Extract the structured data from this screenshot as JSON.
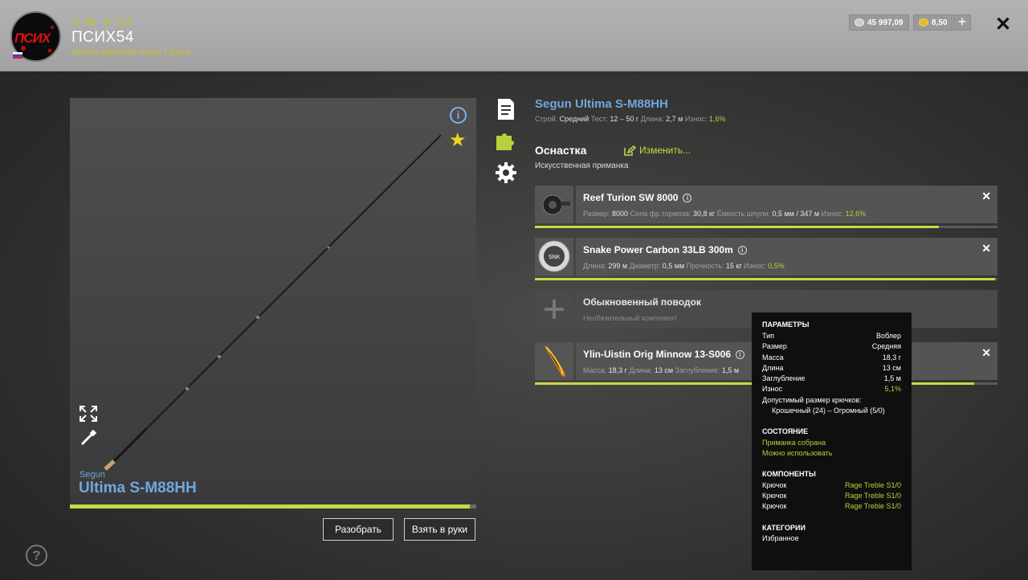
{
  "header": {
    "logo_text": "ПСИХ",
    "level": "48",
    "stars": "114",
    "username": "ПСИХ54",
    "rank": "Мастер карповой ловли 7 ранга",
    "silver": "45 997,09",
    "gold": "8,50",
    "add_label": "+",
    "close_label": "✕"
  },
  "rod_panel": {
    "brand": "Segun",
    "model": "Ultima S-M88HH",
    "wear_fraction": 0.985,
    "disassemble_label": "Разобрать",
    "take_label": "Взять в руки",
    "help_label": "?"
  },
  "rod_info": {
    "title": "Segun Ultima S-M88HH",
    "stats": [
      {
        "label": "Строй:",
        "value": "Средний"
      },
      {
        "label": "Тест:",
        "value": "12 – 50 г"
      },
      {
        "label": "Длина:",
        "value": "2,7 м"
      },
      {
        "label": "Износ:",
        "value": "1,6%"
      }
    ],
    "rigging_title": "Оснастка",
    "edit_label": "Изменить...",
    "rig_type": "Искусственная приманка"
  },
  "slots": [
    {
      "name": "Reef Turion SW 8000",
      "stats": [
        {
          "label": "Размер:",
          "value": "8000"
        },
        {
          "label": "Сила фр.тормоза:",
          "value": "30,8 кг"
        },
        {
          "label": "Ёмкость шпули:",
          "value": "0,5 мм / 347 м"
        },
        {
          "label": "Износ:",
          "value": "12,6%"
        }
      ],
      "wear_fraction": 0.874
    },
    {
      "name": "Snake Power Carbon 33LB 300m",
      "stats": [
        {
          "label": "Длина:",
          "value": "299 м"
        },
        {
          "label": "Диаметр:",
          "value": "0,5 мм"
        },
        {
          "label": "Прочность:",
          "value": "15 кг"
        },
        {
          "label": "Износ:",
          "value": "0,5%"
        }
      ],
      "wear_fraction": 0.995
    },
    {
      "name": "Обыкновенный поводок",
      "subtitle": "Необязательный компонент"
    },
    {
      "name": "Ylin-Uistin Orig Minnow 13-S006",
      "stats": [
        {
          "label": "Масса:",
          "value": "18,3 г"
        },
        {
          "label": "Длина:",
          "value": "13 см"
        },
        {
          "label": "Заглубление:",
          "value": "1,5 м"
        }
      ],
      "wear_fraction": 0.949
    }
  ],
  "tooltip": {
    "params_title": "ПАРАМЕТРЫ",
    "params": [
      {
        "label": "Тип",
        "value": "Воблер"
      },
      {
        "label": "Размер",
        "value": "Средняя"
      },
      {
        "label": "Масса",
        "value": "18,3 г"
      },
      {
        "label": "Длина",
        "value": "13 см"
      },
      {
        "label": "Заглубление",
        "value": "1,5 м"
      },
      {
        "label": "Износ",
        "value": "5,1%"
      }
    ],
    "hook_size_label": "Допустимый размер крючков:",
    "hook_size_value": "Крошечный (24) – Огромный (5/0)",
    "state_title": "СОСТОЯНИЕ",
    "state_lines": [
      "Приманка собрана",
      "Можно использовать"
    ],
    "components_title": "КОМПОНЕНТЫ",
    "components": [
      {
        "label": "Крючок",
        "value": "Rage Treble S1/0"
      },
      {
        "label": "Крючок",
        "value": "Rage Treble S1/0"
      },
      {
        "label": "Крючок",
        "value": "Rage Treble S1/0"
      }
    ],
    "categories_title": "КАТЕГОРИИ",
    "category": "Избранное"
  },
  "colors": {
    "accent_blue": "#6fa7e0",
    "accent_green": "#c9d84a",
    "gold_star": "#f0d320"
  }
}
